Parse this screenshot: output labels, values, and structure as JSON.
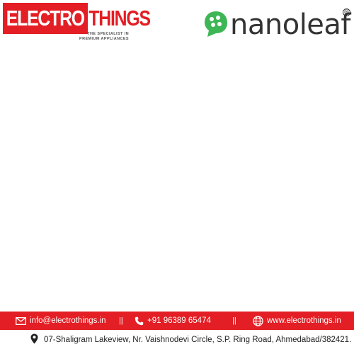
{
  "brand_left": {
    "electro": "ELECTRO",
    "things": "THINGS",
    "tagline_1": "THE SPECIALIST IN",
    "tagline_2": "PREMIUM APPLIANCES"
  },
  "brand_right": {
    "wordmark": "nanoleaf",
    "registered": "®"
  },
  "footer": {
    "email": "info@electrothings.in",
    "phone": "+91 96389 65474",
    "website": "www.electrothings.in",
    "separator": "||",
    "address": "07-Shaligram Lakeview, Nr. Vaishnodevi Circle, S.P. Ring Road, Ahmedabad/382421."
  },
  "colors": {
    "brand_red": "#e31e24",
    "nanoleaf_green": "#3eb655",
    "text_dark": "#333333"
  },
  "icons": [
    "email-icon",
    "phone-icon",
    "globe-icon",
    "location-pin-icon",
    "nanoleaf-mark-icon"
  ]
}
